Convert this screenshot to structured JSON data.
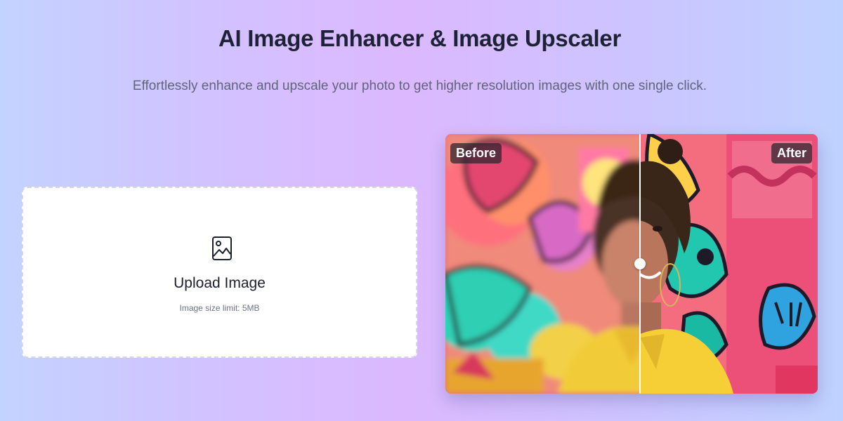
{
  "header": {
    "title": "AI Image Enhancer & Image Upscaler",
    "subtitle": "Effortlessly enhance and upscale your photo to get higher resolution images with one single click."
  },
  "upload": {
    "icon": "image-icon",
    "label": "Upload Image",
    "hint": "Image size limit: 5MB"
  },
  "comparison": {
    "before_label": "Before",
    "after_label": "After",
    "slider_position": 0.52
  },
  "colors": {
    "title": "#1e2236",
    "subtitle": "#606579",
    "card_background": "#ffffff",
    "card_border": "#d5d8e2",
    "tag_background": "#28222c"
  }
}
